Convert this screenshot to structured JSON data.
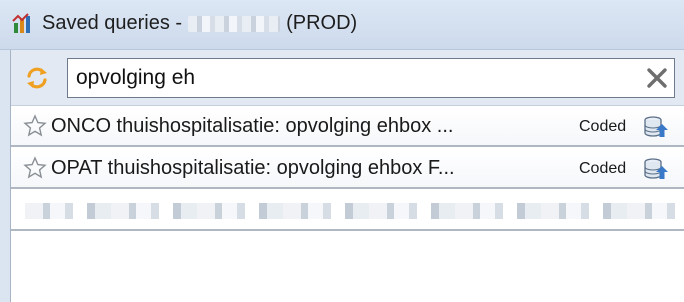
{
  "window": {
    "title_prefix": "Saved queries -",
    "title_suffix": "(PROD)"
  },
  "search": {
    "value": "opvolging eh",
    "refresh_icon": "refresh-icon",
    "clear_icon": "close-icon"
  },
  "results": [
    {
      "name": "ONCO thuishospitalisatie: opvolging ehbox ...",
      "status": "Coded",
      "favorite_icon": "star-outline-icon",
      "action_icon": "database-upload-icon"
    },
    {
      "name": "OPAT thuishospitalisatie: opvolging ehbox F...",
      "status": "Coded",
      "favorite_icon": "star-outline-icon",
      "action_icon": "database-upload-icon"
    }
  ],
  "colors": {
    "titlebar": "#cddaec",
    "row_border": "#aeb7c2",
    "icon_orange": "#f0a020",
    "icon_blue": "#3a78c8"
  }
}
